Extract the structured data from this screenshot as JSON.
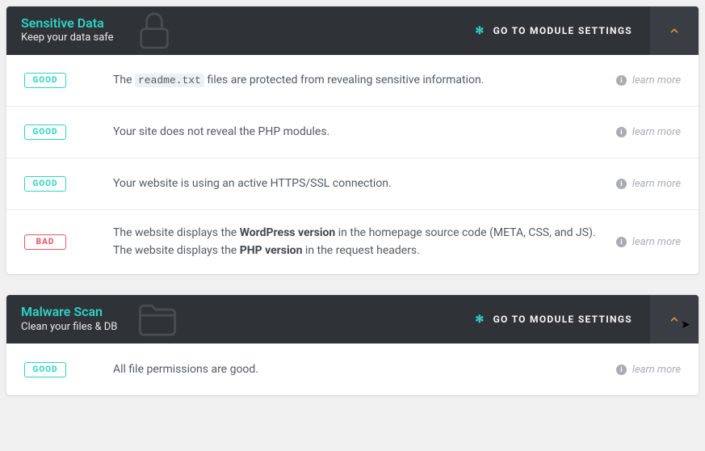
{
  "labels": {
    "good": "GOOD",
    "bad": "BAD",
    "learn_more": "learn more",
    "settings_btn": "GO TO MODULE SETTINGS"
  },
  "modules": [
    {
      "title": "Sensitive Data",
      "subtitle": "Keep your data safe",
      "icon": "lock",
      "rows": [
        {
          "status": "good",
          "html": "The <code>readme.txt</code> files are protected from revealing sensitive information."
        },
        {
          "status": "good",
          "html": "Your site does not reveal the PHP modules."
        },
        {
          "status": "good",
          "html": "Your website is using an active HTTPS/SSL connection."
        },
        {
          "status": "bad",
          "html": "The website displays the <b>WordPress version</b> in the homepage source code (META, CSS, and JS).<br>The website displays the <b>PHP version</b> in the request headers."
        }
      ]
    },
    {
      "title": "Malware Scan",
      "subtitle": "Clean your files & DB",
      "icon": "folder",
      "rows": [
        {
          "status": "good",
          "html": "All file permissions are good."
        }
      ]
    }
  ]
}
